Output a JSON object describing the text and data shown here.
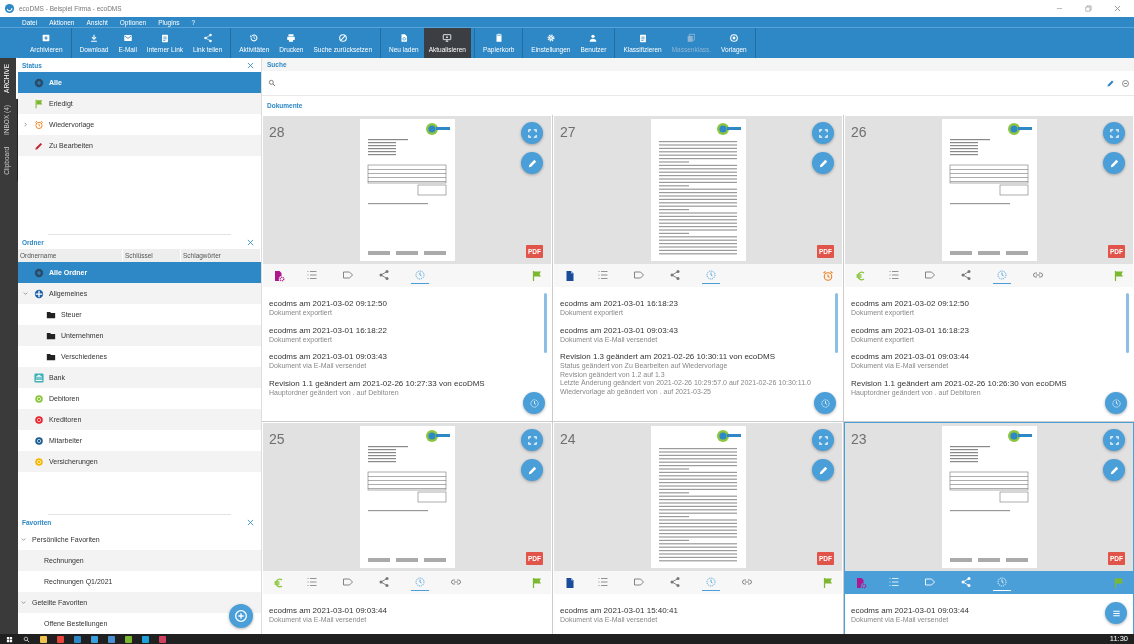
{
  "window": {
    "title": "ecoDMS - Beispiel Firma - ecoDMS"
  },
  "menu": [
    "Datei",
    "Aktionen",
    "Ansicht",
    "Optionen",
    "Plugins",
    "?"
  ],
  "toolbar": [
    [
      {
        "label": "Archivieren",
        "selected": false,
        "disabled": false
      }
    ],
    [
      {
        "label": "Download",
        "selected": false,
        "disabled": false
      },
      {
        "label": "E-Mail",
        "selected": false,
        "disabled": false
      },
      {
        "label": "Interner Link",
        "selected": false,
        "disabled": false
      },
      {
        "label": "Link teilen",
        "selected": false,
        "disabled": false
      }
    ],
    [
      {
        "label": "Aktivitäten",
        "selected": false,
        "disabled": false
      },
      {
        "label": "Drucken",
        "selected": false,
        "disabled": false
      },
      {
        "label": "Suche zurücksetzen",
        "selected": false,
        "disabled": false
      }
    ],
    [
      {
        "label": "Neu laden",
        "selected": false,
        "disabled": false
      },
      {
        "label": "Aktualisieren",
        "selected": true,
        "disabled": false
      }
    ],
    [
      {
        "label": "Papierkorb",
        "selected": false,
        "disabled": false
      }
    ],
    [
      {
        "label": "Einstellungen",
        "selected": false,
        "disabled": false
      },
      {
        "label": "Benutzer",
        "selected": false,
        "disabled": false
      }
    ],
    [
      {
        "label": "Klassifizieren",
        "selected": false,
        "disabled": false
      },
      {
        "label": "Massenklass.",
        "selected": false,
        "disabled": true
      },
      {
        "label": "Vorlagen",
        "selected": false,
        "disabled": false
      }
    ]
  ],
  "side_tabs": [
    {
      "label": "ARCHIVE",
      "selected": true
    },
    {
      "label": "INBOX (4)",
      "selected": false
    },
    {
      "label": "Clipboard",
      "selected": false
    }
  ],
  "status_panel": {
    "title": "Status",
    "items": [
      {
        "label": "Alle",
        "kind": "all",
        "selected": true
      },
      {
        "label": "Erledigt",
        "kind": "done",
        "selected": false
      },
      {
        "label": "Wiedervorlage",
        "kind": "resubmission",
        "selected": false,
        "expanded": false
      },
      {
        "label": "Zu Bearbeiten",
        "kind": "edit",
        "selected": false
      }
    ]
  },
  "folder_panel": {
    "title": "Ordner",
    "columns": [
      "Ordnername",
      "Schlüssel",
      "Schlagwörter"
    ],
    "items": [
      {
        "label": "Alle Ordner",
        "kind": "all",
        "selected": true
      },
      {
        "label": "Allgemeines",
        "kind": "group",
        "color": "#1f5fa8",
        "selected": false,
        "expanded": true,
        "children": [
          {
            "label": "Steuer",
            "kind": "folder",
            "selected": false
          },
          {
            "label": "Unternehmen",
            "kind": "folder",
            "selected": false
          },
          {
            "label": "Verschiedenes",
            "kind": "folder",
            "selected": false
          }
        ]
      },
      {
        "label": "Bank",
        "kind": "bank",
        "color": "#3fb0b8",
        "selected": false
      },
      {
        "label": "Debitoren",
        "kind": "category",
        "color": "#8cc63f",
        "selected": false
      },
      {
        "label": "Kreditoren",
        "kind": "category",
        "color": "#e8232a",
        "selected": false
      },
      {
        "label": "Mitarbeiter",
        "kind": "category",
        "color": "#1b5e8f",
        "selected": false
      },
      {
        "label": "Versicherungen",
        "kind": "category",
        "color": "#f5b800",
        "selected": false
      }
    ]
  },
  "favorites_panel": {
    "title": "Favoriten",
    "items": [
      {
        "label": "Persönliche Favoriten",
        "expanded": true,
        "children": [
          {
            "label": "Rechnungen"
          },
          {
            "label": "Rechnungen Q1/2021"
          }
        ]
      },
      {
        "label": "Geteilte Favoriten",
        "expanded": true,
        "children": [
          {
            "label": "Offene Bestellungen"
          }
        ]
      }
    ]
  },
  "search": {
    "title": "Suche"
  },
  "documents": {
    "title": "Dokumente",
    "cards": [
      {
        "number": "28",
        "kind": "invoice",
        "badge": "PDF",
        "done": true,
        "selected": false,
        "tabs": [
          {
            "kind": "details",
            "selected": false
          },
          {
            "kind": "tags",
            "selected": false
          },
          {
            "kind": "share",
            "selected": false
          },
          {
            "kind": "history",
            "selected": true
          }
        ],
        "history": [
          {
            "title": "ecodms am 2021-03-02 09:12:50",
            "lines": [
              "Dokument exportiert"
            ]
          },
          {
            "title": "ecodms am 2021-03-01 16:18:22",
            "lines": [
              "Dokument exportiert"
            ]
          },
          {
            "title": "ecodms am 2021-03-01 09:03:43",
            "lines": [
              "Dokument via E-Mail versendet"
            ]
          },
          {
            "title": "Revision 1.1 geändert am 2021-02-26 10:27:33 von ecoDMS",
            "lines": [
              "Hauptordner geändert von . auf Debitoren"
            ]
          }
        ]
      },
      {
        "number": "27",
        "kind": "letter",
        "badge": "PDF",
        "done": false,
        "selected": false,
        "tabs": [
          {
            "kind": "details",
            "selected": false
          },
          {
            "kind": "tags",
            "selected": false
          },
          {
            "kind": "share",
            "selected": false
          },
          {
            "kind": "history",
            "selected": true
          }
        ],
        "history": [
          {
            "title": "ecodms am 2021-03-01 16:18:23",
            "lines": [
              "Dokument exportiert"
            ]
          },
          {
            "title": "ecodms am 2021-03-01 09:03:43",
            "lines": [
              "Dokument via E-Mail versendet"
            ]
          },
          {
            "title": "Revision 1.3 geändert am 2021-02-26 10:30:11 von ecoDMS",
            "lines": [
              "Status geändert von Zu Bearbeiten auf Wiedervorlage",
              "Revision geändert von 1.2 auf 1.3",
              "Letzte Änderung geändert von 2021-02-26 10:29:57.0 auf 2021-02-26 10:30:11.0",
              "Wiedervorlage ab geändert von . auf 2021-03-25"
            ]
          }
        ]
      },
      {
        "number": "26",
        "kind": "payment",
        "badge": "PDF",
        "done": true,
        "selected": false,
        "tabs": [
          {
            "kind": "details",
            "selected": false
          },
          {
            "kind": "tags",
            "selected": false
          },
          {
            "kind": "share",
            "selected": false
          },
          {
            "kind": "history",
            "selected": true
          },
          {
            "kind": "link",
            "selected": false
          }
        ],
        "history": [
          {
            "title": "ecodms am 2021-03-02 09:12:50",
            "lines": [
              "Dokument exportiert"
            ]
          },
          {
            "title": "ecodms am 2021-03-01 16:18:23",
            "lines": [
              "Dokument exportiert"
            ]
          },
          {
            "title": "ecodms am 2021-03-01 09:03:44",
            "lines": [
              "Dokument via E-Mail versendet"
            ]
          },
          {
            "title": "Revision 1.1 geändert am 2021-02-26 10:26:30 von ecoDMS",
            "lines": [
              "Hauptordner geändert von . auf Debitoren"
            ]
          }
        ]
      },
      {
        "number": "25",
        "kind": "payment",
        "badge": "PDF",
        "done": true,
        "selected": false,
        "tabs": [
          {
            "kind": "details",
            "selected": false
          },
          {
            "kind": "tags",
            "selected": false
          },
          {
            "kind": "share",
            "selected": false
          },
          {
            "kind": "history",
            "selected": true
          },
          {
            "kind": "link",
            "selected": false
          }
        ],
        "history": [
          {
            "title": "ecodms am 2021-03-01 09:03:44",
            "lines": [
              "Dokument via E-Mail versendet"
            ]
          }
        ]
      },
      {
        "number": "24",
        "kind": "letter",
        "badge": "PDF",
        "done": true,
        "selected": false,
        "tabs": [
          {
            "kind": "details",
            "selected": false
          },
          {
            "kind": "tags",
            "selected": false
          },
          {
            "kind": "share",
            "selected": false
          },
          {
            "kind": "history",
            "selected": true
          },
          {
            "kind": "link",
            "selected": false
          }
        ],
        "history": [
          {
            "title": "ecodms am 2021-03-01 15:40:41",
            "lines": [
              "Dokument via E-Mail versendet"
            ]
          }
        ]
      },
      {
        "number": "23",
        "kind": "invoice",
        "badge": "PDF",
        "done": true,
        "selected": true,
        "tabs": [
          {
            "kind": "details",
            "selected": false
          },
          {
            "kind": "tags",
            "selected": false
          },
          {
            "kind": "share",
            "selected": false
          },
          {
            "kind": "history",
            "selected": true
          }
        ],
        "history": [
          {
            "title": "ecodms am 2021-03-01 09:03:44",
            "lines": [
              "Dokument via E-Mail versendet"
            ]
          }
        ]
      }
    ]
  },
  "taskbar": {
    "time": "11:30"
  }
}
